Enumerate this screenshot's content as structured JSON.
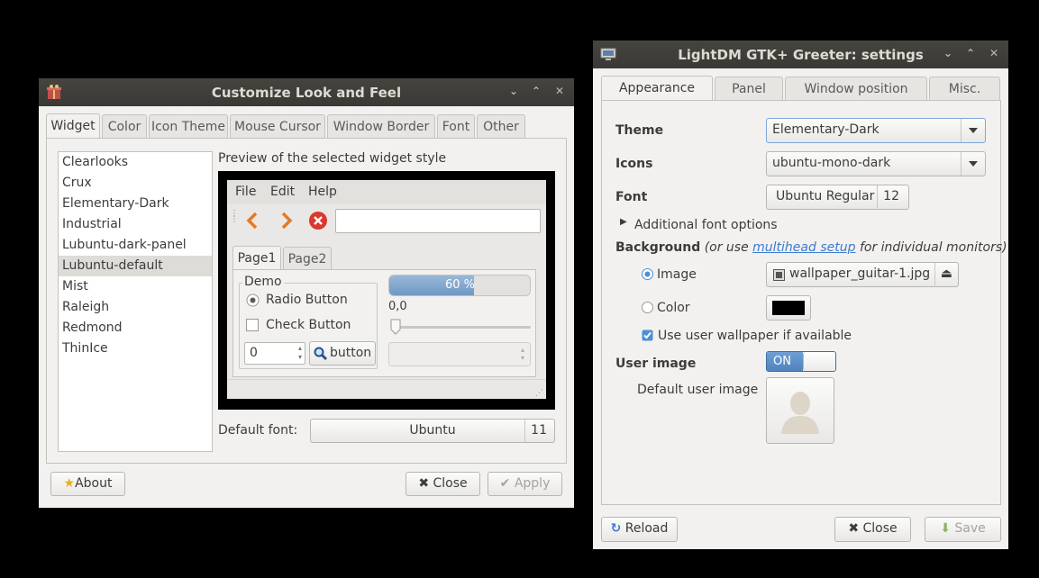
{
  "left_window": {
    "title": "Customize Look and Feel",
    "tabs": [
      "Widget",
      "Color",
      "Icon Theme",
      "Mouse Cursor",
      "Window Border",
      "Font",
      "Other"
    ],
    "active_tab": "Widget",
    "theme_list": [
      "Clearlooks",
      "Crux",
      "Elementary-Dark",
      "Industrial",
      "Lubuntu-dark-panel",
      "Lubuntu-default",
      "Mist",
      "Raleigh",
      "Redmond",
      "ThinIce"
    ],
    "selected_theme": "Lubuntu-default",
    "preview_label": "Preview of the selected widget style",
    "preview": {
      "menu": [
        "File",
        "Edit",
        "Help"
      ],
      "tabs": [
        "Page1",
        "Page2"
      ],
      "group_label": "Demo",
      "radio_label": "Radio Button",
      "check_label": "Check Button",
      "spin_value": "0",
      "button_label": "button",
      "progress_text": "60 %",
      "progress_value": 0.6,
      "scale_value": "0,0"
    },
    "default_font_label": "Default font:",
    "font_name": "Ubuntu",
    "font_size": "11",
    "about_label": "About",
    "close_label": "Close",
    "apply_label": "Apply"
  },
  "right_window": {
    "title": "LightDM GTK+ Greeter: settings",
    "tabs": [
      "Appearance",
      "Panel",
      "Window position",
      "Misc."
    ],
    "active_tab": "Appearance",
    "theme_label": "Theme",
    "theme_value": "Elementary-Dark",
    "icons_label": "Icons",
    "icons_value": "ubuntu-mono-dark",
    "font_label": "Font",
    "font_name": "Ubuntu Regular",
    "font_size": "12",
    "additional_font_options": "Additional font options",
    "background_label": "Background",
    "background_hint_pre": "(or use",
    "background_hint_link": "multihead setup",
    "background_hint_post": "for individual monitors)",
    "image_label": "Image",
    "image_file": "wallpaper_guitar-1.jpg",
    "color_label": "Color",
    "color_value": "#000000",
    "use_user_wallpaper": "Use user wallpaper if available",
    "user_image_label": "User image",
    "toggle_state": "ON",
    "default_user_image_label": "Default user image",
    "reload_label": "Reload",
    "close_label": "Close",
    "save_label": "Save"
  }
}
